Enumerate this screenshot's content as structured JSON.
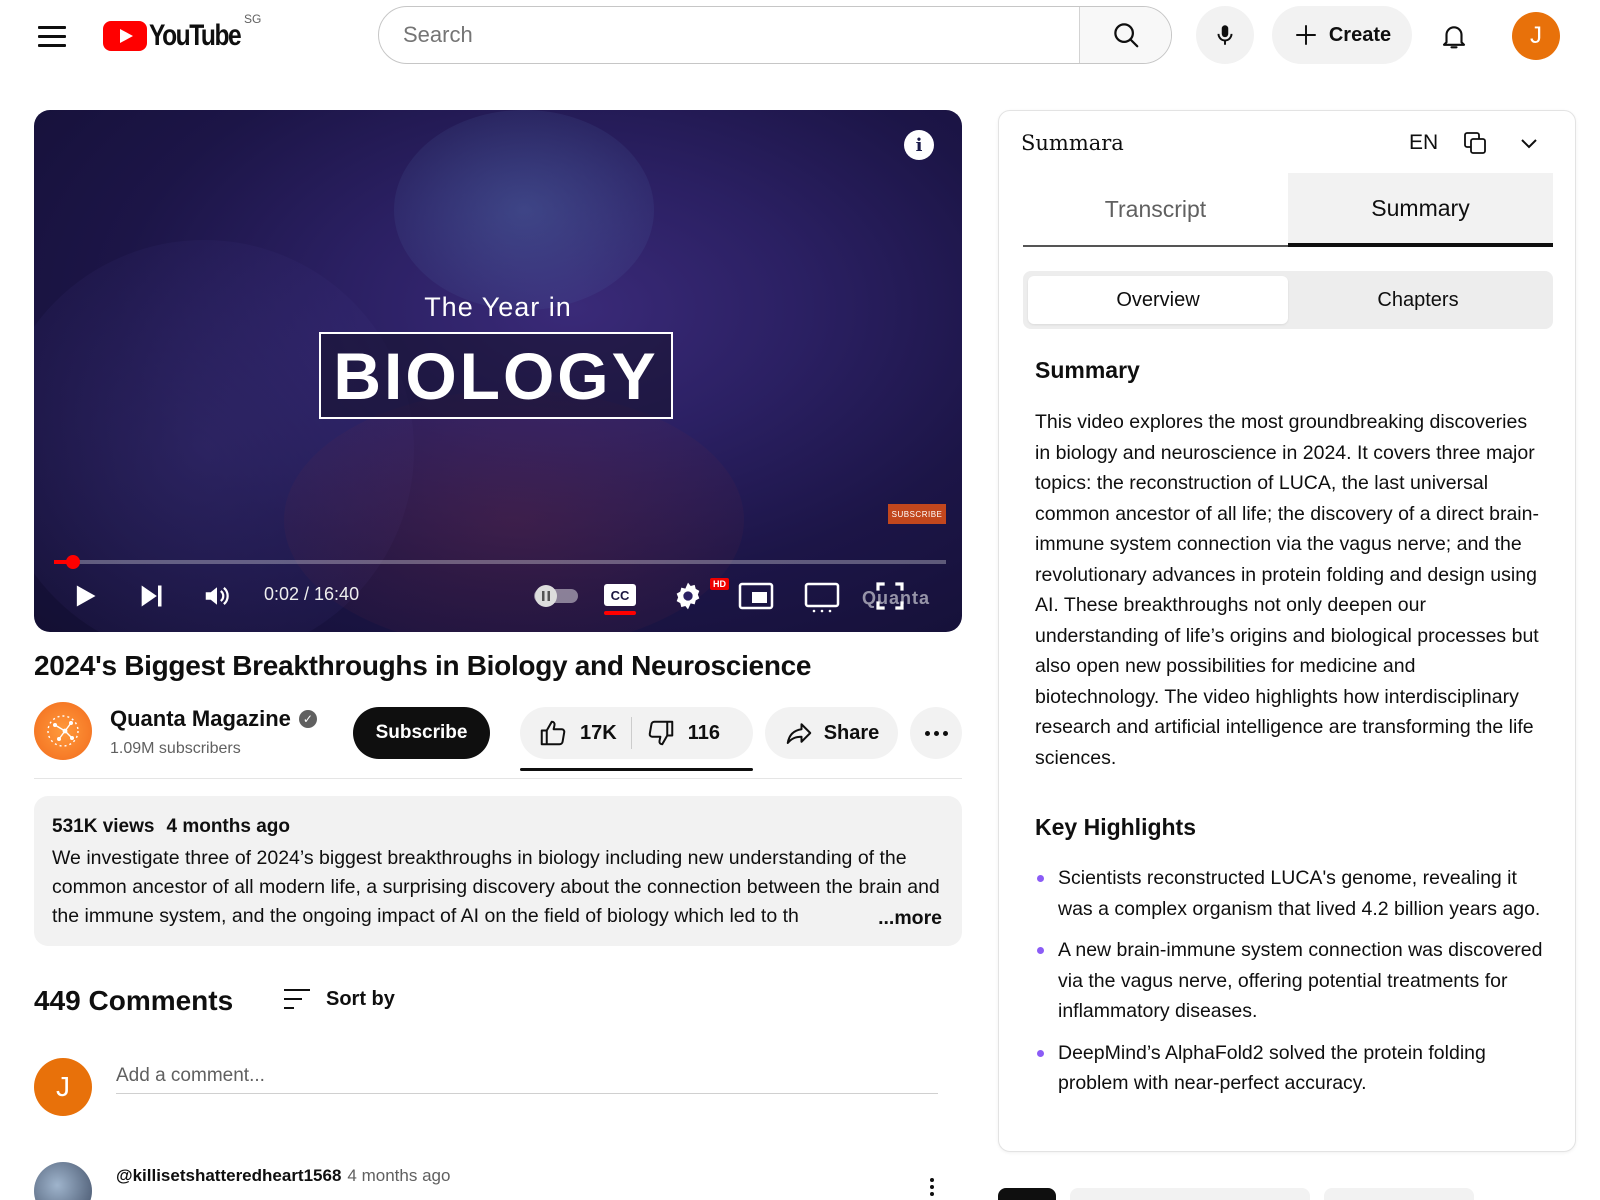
{
  "header": {
    "logo_text": "YouTube",
    "region": "SG",
    "search_placeholder": "Search",
    "create_label": "Create",
    "avatar_initial": "J"
  },
  "player": {
    "overlay_small": "The Year in",
    "overlay_big": "BIOLOGY",
    "subscribe_badge": "SUBSCRIBE",
    "time": "0:02 / 16:40",
    "progress_fraction": 0.002,
    "watermark": "Quanta",
    "hd_badge": "HD",
    "info_glyph": "i"
  },
  "video": {
    "title": "2024's Biggest Breakthroughs in Biology and Neuroscience",
    "channel_name": "Quanta Magazine",
    "subscribers": "1.09M subscribers",
    "subscribe_label": "Subscribe",
    "likes": "17K",
    "dislikes": "116",
    "share_label": "Share"
  },
  "description": {
    "views": "531K views",
    "age": "4 months ago",
    "text": "We investigate three of 2024’s biggest breakthroughs in biology including new understanding of the common ancestor of all modern life, a surprising discovery about the connection between the brain and the immune system, and the ongoing impact of AI on the field of biology which led to th",
    "more_label": "...more"
  },
  "comments": {
    "count_label": "449 Comments",
    "sort_label": "Sort by",
    "add_placeholder": "Add a comment...",
    "user_initial": "J",
    "first": {
      "user": "@killisetshatteredheart1568",
      "time": "4 months ago"
    }
  },
  "panel": {
    "title": "Summara",
    "lang": "EN",
    "tabs": [
      "Transcript",
      "Summary"
    ],
    "active_tab": "Summary",
    "segments": [
      "Overview",
      "Chapters"
    ],
    "active_segment": "Overview",
    "summary_heading": "Summary",
    "summary_text": "This video explores the most groundbreaking discoveries in biology and neuroscience in 2024. It covers three major topics: the reconstruction of LUCA, the last universal common ancestor of all life; the discovery of a direct brain-immune system connection via the vagus nerve; and the revolutionary advances in protein folding and design using AI. These breakthroughs not only deepen our understanding of life’s origins and biological processes but also open new possibilities for medicine and biotechnology. The video highlights how interdisciplinary research and artificial intelligence are transforming the life sciences.",
    "highlights_heading": "Key Highlights",
    "highlights": [
      "Scientists reconstructed LUCA's genome, revealing it was a complex organism that lived 4.2 billion years ago.",
      "A new brain-immune system connection was discovered via the vagus nerve, offering potential treatments for inflammatory diseases.",
      "DeepMind’s AlphaFold2 solved the protein folding problem with near-perfect accuracy."
    ]
  },
  "colors": {
    "brand_red": "#ff0000",
    "avatar_orange": "#e8710a",
    "bullet_purple": "#8b5cf6"
  }
}
